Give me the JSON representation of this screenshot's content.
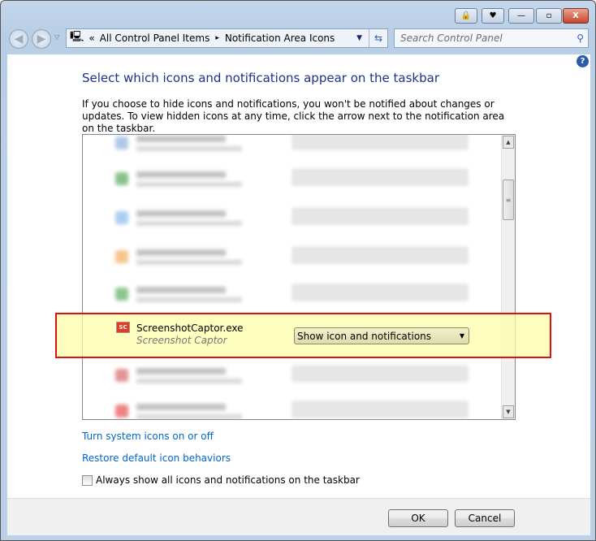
{
  "titlebar": {
    "minimize": "—",
    "maximize": "▫",
    "close": "X"
  },
  "address": {
    "overflow": "«",
    "crumbs": [
      "All Control Panel Items",
      "Notification Area Icons"
    ],
    "separator": "▸"
  },
  "search": {
    "placeholder": "Search Control Panel"
  },
  "main": {
    "heading": "Select which icons and notifications appear on the taskbar",
    "description": "If you choose to hide icons and notifications, you won't be notified about changes or updates. To view hidden icons at any time, click the arrow next to the notification area on the taskbar.",
    "highlighted_item": {
      "name": "ScreenshotCaptor.exe",
      "publisher": "Screenshot Captor",
      "icon_label": "SC",
      "behavior": "Show icon and notifications"
    },
    "blurred_icon_colors": [
      "#7aa3d8",
      "#3c9a3c",
      "#6eaee8",
      "#f0a040",
      "#40a040",
      "#d05050",
      "#e03030"
    ],
    "links": [
      "Turn system icons on or off",
      "Restore default icon behaviors"
    ],
    "checkbox": {
      "label": "Always show all icons and notifications on the taskbar",
      "checked": false
    }
  },
  "footer": {
    "ok": "OK",
    "cancel": "Cancel"
  },
  "colors": {
    "highlight_border": "#e01010",
    "highlight_fill": "#fdfdaa",
    "link": "#0066cc"
  }
}
